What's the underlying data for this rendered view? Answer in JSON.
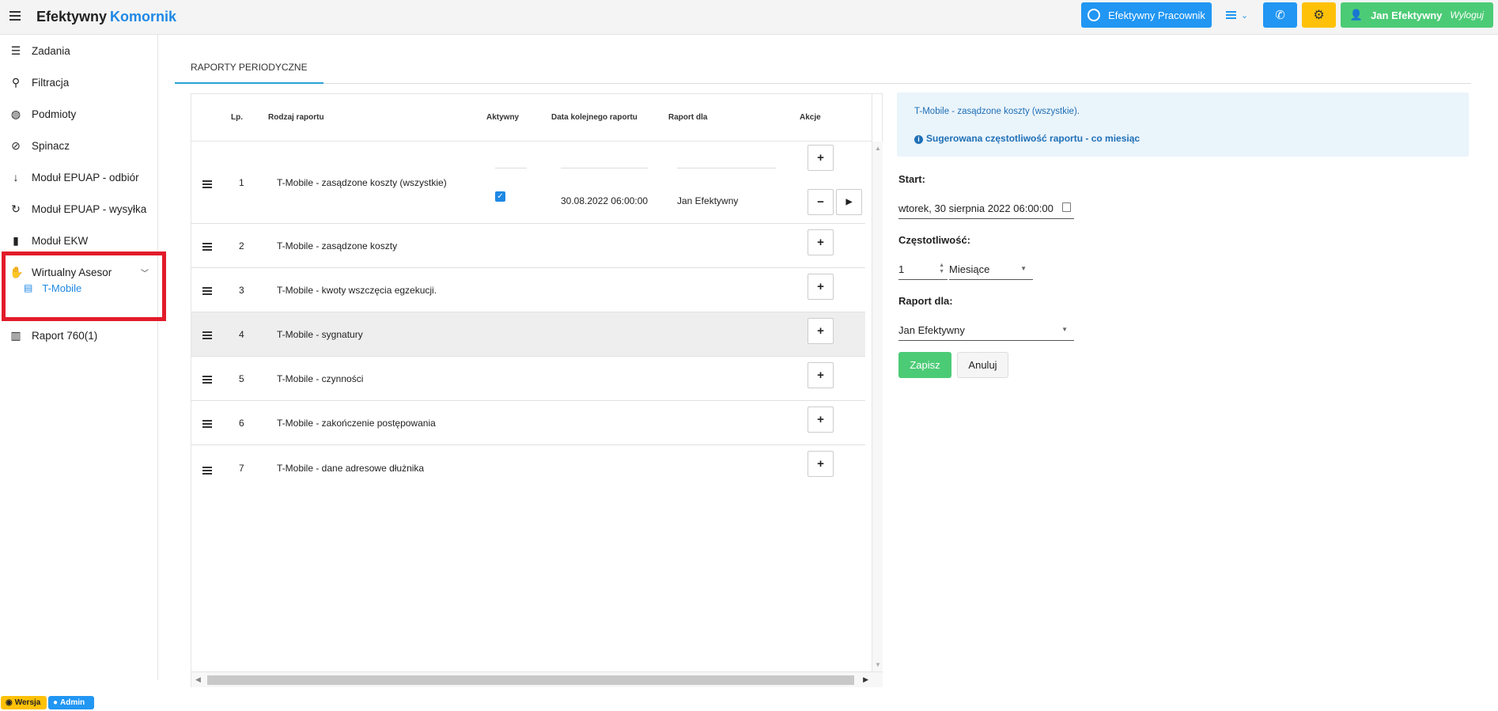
{
  "header": {
    "brand_main": "Efektywny",
    "brand_accent": "Komornik",
    "ep_button": "Efektywny Pracownik",
    "user_name": "Jan Efektywny",
    "logout": "Wyloguj",
    "accent_color": "#2196f3",
    "user_color": "#4ccb76",
    "gear_color": "#ffc107"
  },
  "sidebar": {
    "items": [
      {
        "label": "Zadania",
        "icon": "list-icon"
      },
      {
        "label": "Filtracja",
        "icon": "search-icon"
      },
      {
        "label": "Podmioty",
        "icon": "globe-icon"
      },
      {
        "label": "Spinacz",
        "icon": "paperclip-icon"
      },
      {
        "label": "Moduł EPUAP - odbiór",
        "icon": "arrow-down-icon"
      },
      {
        "label": "Moduł EPUAP - wysyłka",
        "icon": "redo-icon"
      },
      {
        "label": "Moduł EKW",
        "icon": "book-icon"
      },
      {
        "label": "Wirtualny Asesor",
        "icon": "handshake-icon"
      },
      {
        "label": "Raport 760(1)",
        "icon": "excel-file-icon"
      }
    ],
    "sub_item": {
      "label": "T-Mobile",
      "icon": "excel-file-icon"
    }
  },
  "tabs": [
    {
      "label": "RAPORTY PERIODYCZNE"
    }
  ],
  "table": {
    "headers": {
      "lp": "Lp.",
      "type": "Rodzaj raportu",
      "active": "Aktywny",
      "next_date": "Data kolejnego raportu",
      "for": "Raport dla",
      "actions": "Akcje"
    },
    "rows": [
      {
        "lp": "1",
        "name": "T-Mobile - zasądzone koszty (wszystkie)",
        "active": true,
        "next_date": "30.08.2022 06:00:00",
        "for": "Jan Efektywny"
      },
      {
        "lp": "2",
        "name": "T-Mobile - zasądzone koszty"
      },
      {
        "lp": "3",
        "name": "T-Mobile - kwoty wszczęcia egzekucji."
      },
      {
        "lp": "4",
        "name": "T-Mobile - sygnatury"
      },
      {
        "lp": "5",
        "name": "T-Mobile - czynności"
      },
      {
        "lp": "6",
        "name": "T-Mobile - zakończenie postępowania"
      },
      {
        "lp": "7",
        "name": "T-Mobile - dane adresowe dłużnika"
      }
    ],
    "btn_add": "+",
    "btn_remove": "−",
    "btn_run": "▶"
  },
  "form": {
    "info_title": "T-Mobile - zasądzone koszty (wszystkie).",
    "info_hint": "Sugerowana częstotliwość raportu - co miesiąc",
    "start_label": "Start:",
    "start_value": "wtorek, 30 sierpnia 2022 06:00:00",
    "freq_label": "Częstotliwość:",
    "freq_number": "1",
    "freq_unit": "Miesiące",
    "for_label": "Raport dla:",
    "for_value": "Jan Efektywny",
    "save": "Zapisz",
    "cancel": "Anuluj"
  },
  "footer": {
    "version": "Wersja",
    "admin": "Admin"
  }
}
